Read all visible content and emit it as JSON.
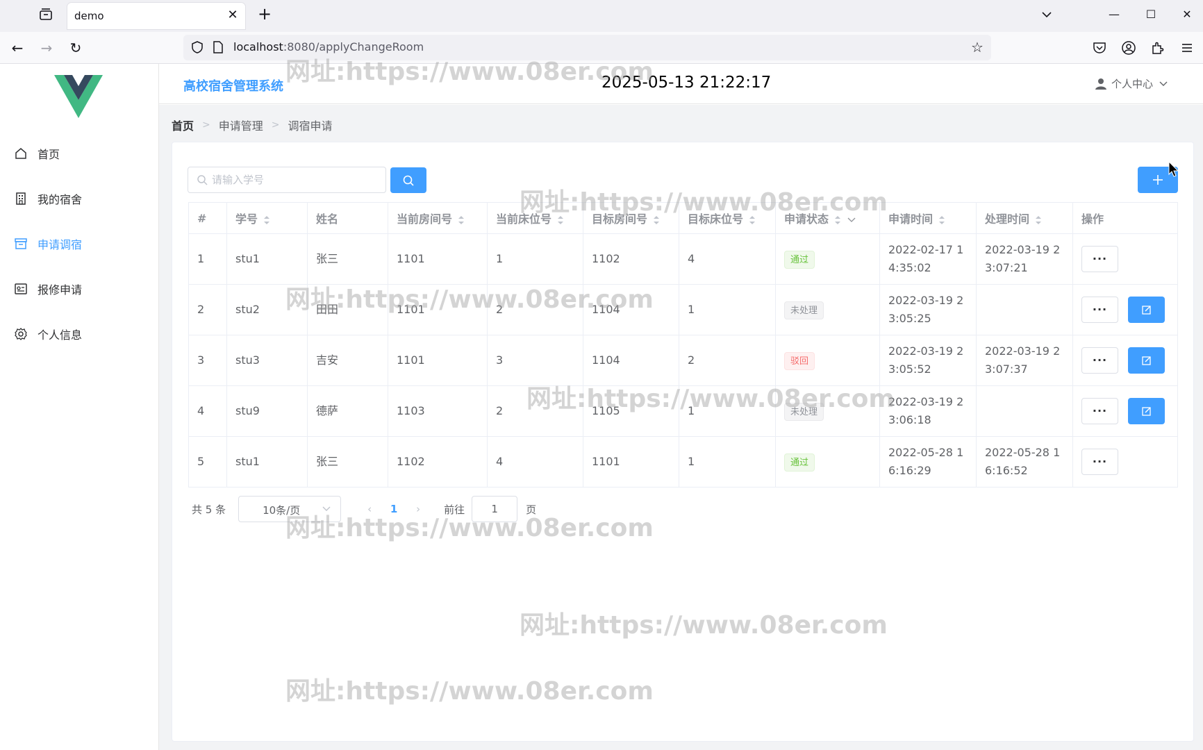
{
  "browser": {
    "tab_title": "demo",
    "url_host": "localhost",
    "url_rest": ":8080/applyChangeRoom"
  },
  "sidebar": {
    "items": [
      {
        "label": "首页",
        "icon": "home-icon",
        "active": false
      },
      {
        "label": "我的宿舍",
        "icon": "building-icon",
        "active": false
      },
      {
        "label": "申请调宿",
        "icon": "archive-icon",
        "active": true
      },
      {
        "label": "报修申请",
        "icon": "form-icon",
        "active": false
      },
      {
        "label": "个人信息",
        "icon": "gear-icon",
        "active": false
      }
    ]
  },
  "header": {
    "title": "高校宿舍管理系统",
    "datetime": "2025-05-13 21:22:17",
    "user_menu": "个人中心"
  },
  "breadcrumb": [
    "首页",
    "申请管理",
    "调宿申请"
  ],
  "search": {
    "placeholder": "请输入学号",
    "value": ""
  },
  "table": {
    "columns": [
      "#",
      "学号",
      "姓名",
      "当前房间号",
      "当前床位号",
      "目标房间号",
      "目标床位号",
      "申请状态",
      "申请时间",
      "处理时间",
      "操作"
    ],
    "rows": [
      {
        "idx": "1",
        "sid": "stu1",
        "name": "张三",
        "cur_room": "1101",
        "cur_bed": "1",
        "tgt_room": "1102",
        "tgt_bed": "4",
        "status": "通过",
        "status_type": "success",
        "apply_time": "2022-02-17 14:35:02",
        "process_time": "2022-03-19 23:07:21",
        "editable": false
      },
      {
        "idx": "2",
        "sid": "stu2",
        "name": "田田",
        "cur_room": "1101",
        "cur_bed": "2",
        "tgt_room": "1104",
        "tgt_bed": "1",
        "status": "未处理",
        "status_type": "info",
        "apply_time": "2022-03-19 23:05:25",
        "process_time": "",
        "editable": true
      },
      {
        "idx": "3",
        "sid": "stu3",
        "name": "吉安",
        "cur_room": "1101",
        "cur_bed": "3",
        "tgt_room": "1104",
        "tgt_bed": "2",
        "status": "驳回",
        "status_type": "danger",
        "apply_time": "2022-03-19 23:05:52",
        "process_time": "2022-03-19 23:07:37",
        "editable": true
      },
      {
        "idx": "4",
        "sid": "stu9",
        "name": "德萨",
        "cur_room": "1103",
        "cur_bed": "2",
        "tgt_room": "1105",
        "tgt_bed": "1",
        "status": "未处理",
        "status_type": "info",
        "apply_time": "2022-03-19 23:06:18",
        "process_time": "",
        "editable": true
      },
      {
        "idx": "5",
        "sid": "stu1",
        "name": "张三",
        "cur_room": "1102",
        "cur_bed": "4",
        "tgt_room": "1101",
        "tgt_bed": "1",
        "status": "通过",
        "status_type": "success",
        "apply_time": "2022-05-28 16:16:29",
        "process_time": "2022-05-28 16:16:52",
        "editable": false
      }
    ],
    "more_label": "···"
  },
  "pagination": {
    "total": "共 5 条",
    "page_size": "10条/页",
    "current_page": "1",
    "goto_label": "前往",
    "goto_value": "1",
    "page_suffix": "页"
  },
  "watermark": "网址:https://www.08er.com",
  "colors": {
    "primary": "#409eff",
    "success": "#67c23a",
    "danger": "#f56c6c",
    "info": "#909399"
  }
}
